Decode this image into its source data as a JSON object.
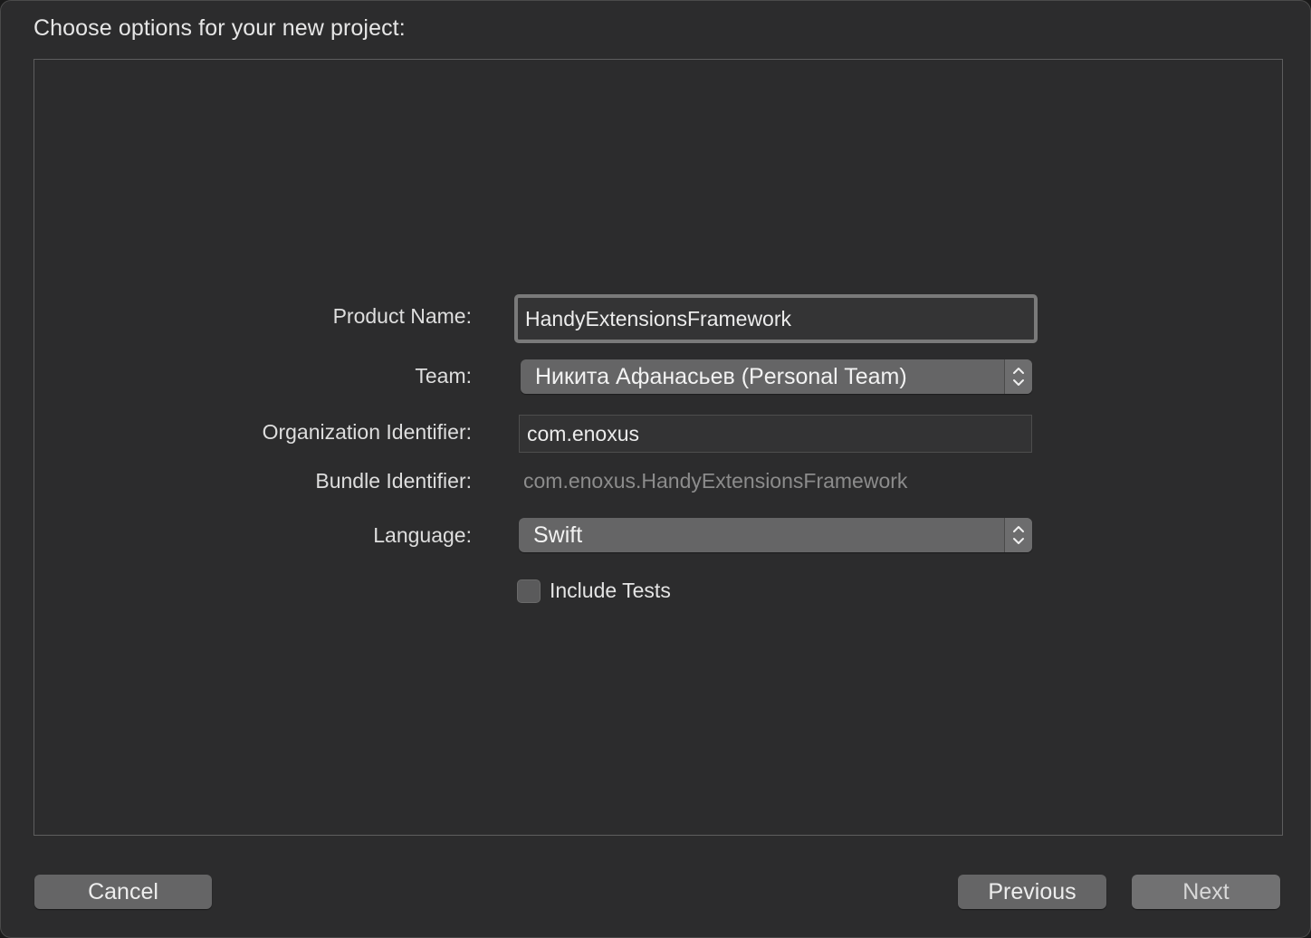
{
  "dialog": {
    "title": "Choose options for your new project:"
  },
  "form": {
    "product_name": {
      "label": "Product Name:",
      "value": "HandyExtensionsFramework"
    },
    "team": {
      "label": "Team:",
      "selected": "Никита Афанасьев (Personal Team)"
    },
    "organization_identifier": {
      "label": "Organization Identifier:",
      "value": "com.enoxus"
    },
    "bundle_identifier": {
      "label": "Bundle Identifier:",
      "value": "com.enoxus.HandyExtensionsFramework"
    },
    "language": {
      "label": "Language:",
      "selected": "Swift"
    },
    "include_tests": {
      "label": "Include Tests",
      "checked": false
    }
  },
  "footer": {
    "cancel_label": "Cancel",
    "previous_label": "Previous",
    "next_label": "Next"
  },
  "icons": {
    "popup_stepper": "chevron-up-down-icon"
  },
  "colors": {
    "window_bg": "#2c2c2d",
    "button_bg": "#656566",
    "text": "#e6e6e6",
    "muted_text": "#8c8c8c"
  }
}
